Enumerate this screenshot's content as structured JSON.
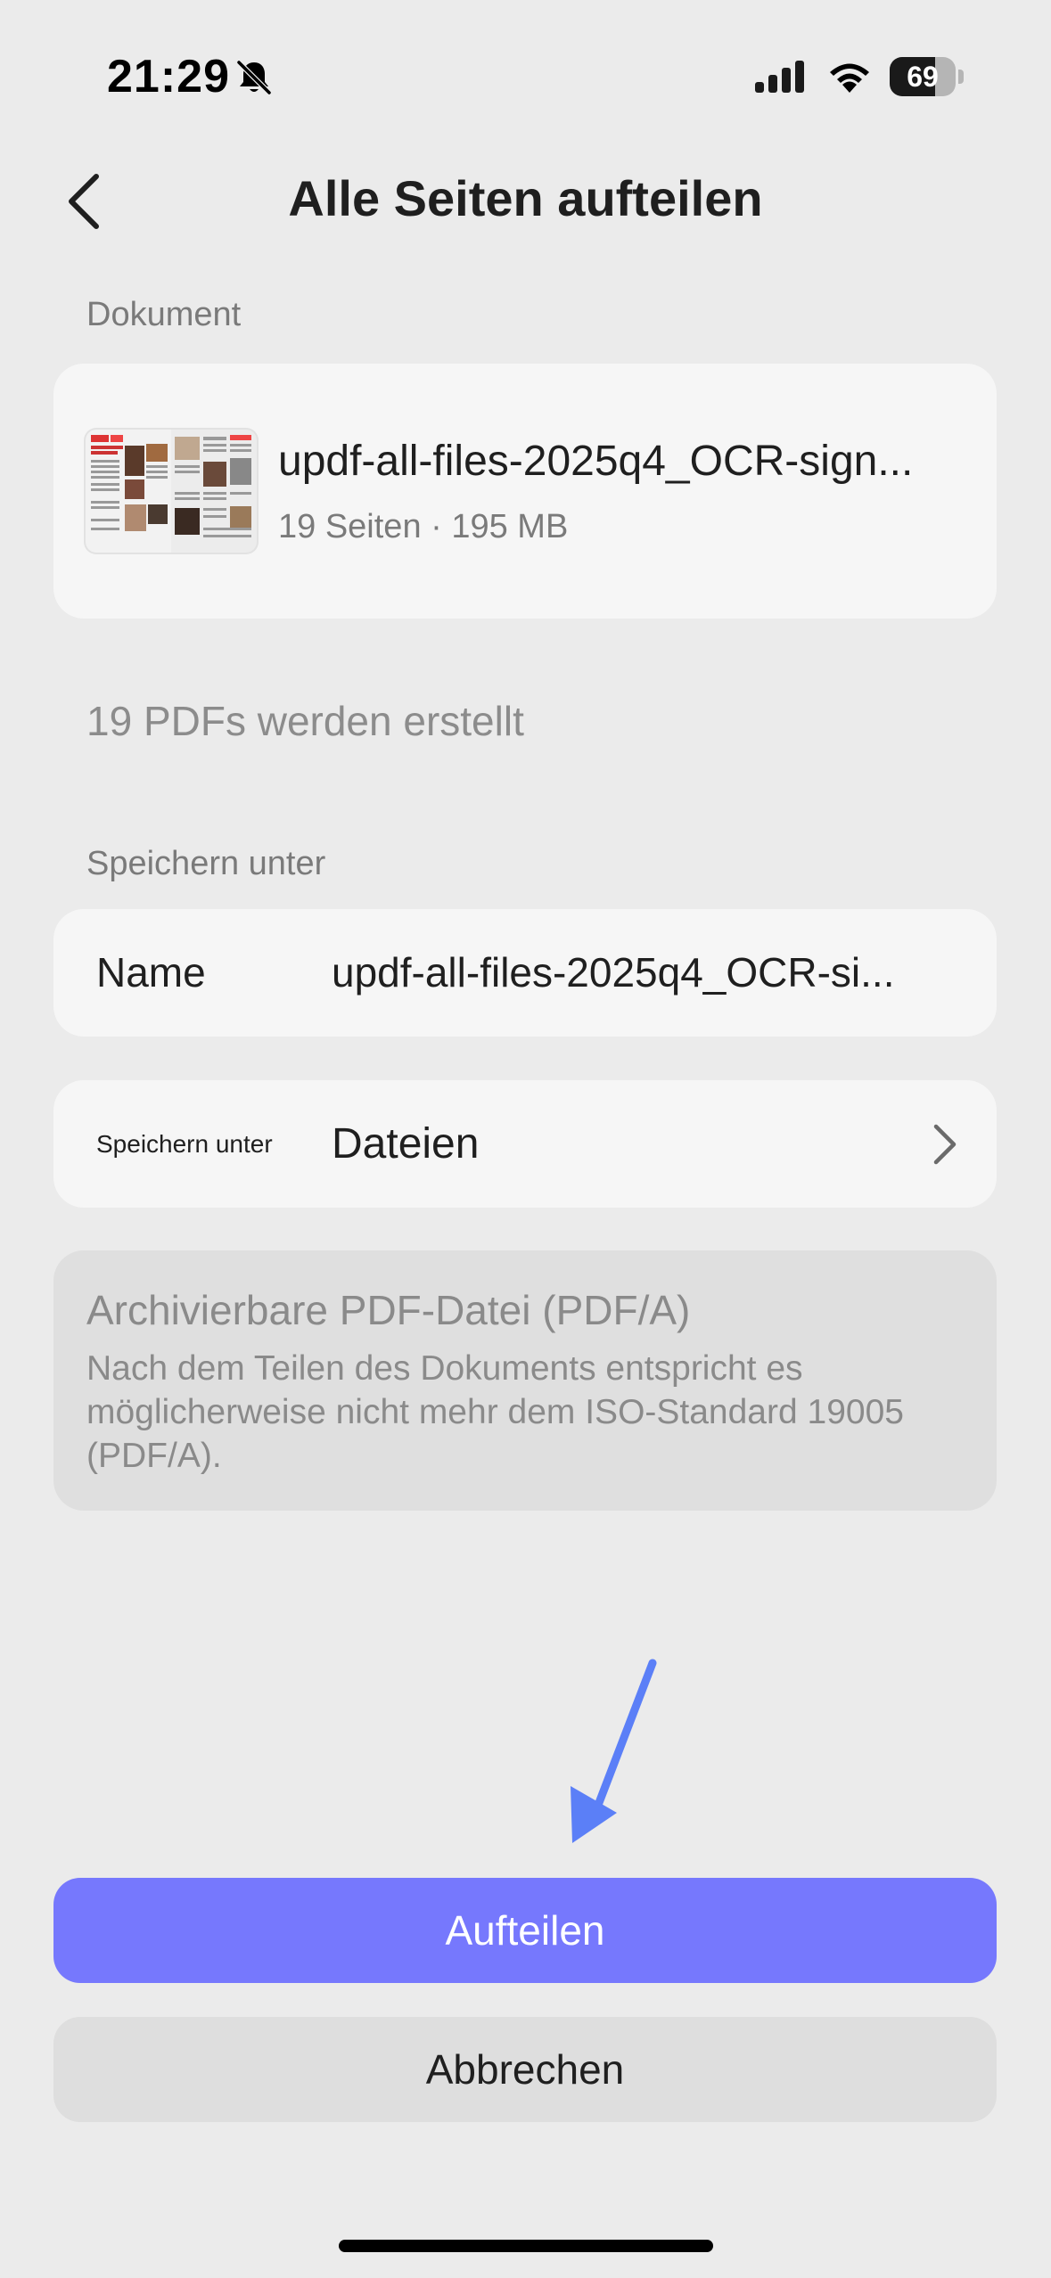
{
  "status_bar": {
    "time": "21:29",
    "battery_level": "69",
    "battery_fraction": 0.69
  },
  "header": {
    "title": "Alle Seiten aufteilen"
  },
  "document_section": {
    "label": "Dokument",
    "file_name": "updf-all-files-2025q4_OCR-sign...",
    "meta": "19 Seiten · 195 MB"
  },
  "pdf_count_text": "19 PDFs werden erstellt",
  "save_section": {
    "label": "Speichern unter",
    "name_label": "Name",
    "name_value": "updf-all-files-2025q4_OCR-si...",
    "location_label": "Speichern unter",
    "location_value": "Dateien"
  },
  "pdfa_notice": {
    "title": "Archivierbare PDF-Datei (PDF/A)",
    "description": "Nach dem Teilen des Dokuments entspricht es möglicherweise nicht mehr dem ISO-Standard 19005 (PDF/A)."
  },
  "buttons": {
    "primary_label": "Aufteilen",
    "secondary_label": "Abbrechen"
  },
  "colors": {
    "background": "#ebebeb",
    "card": "#f6f6f6",
    "disabled_card": "#dfdfdf",
    "primary": "#7678fd",
    "annotation_arrow": "#5b7ff7"
  },
  "icons": {
    "back": "chevron-left-icon",
    "bell": "bell-slash-icon",
    "signal": "cellular-signal-icon",
    "wifi": "wifi-icon",
    "battery": "battery-icon",
    "disclosure": "chevron-right-icon",
    "annotation": "arrow-pointer-icon"
  }
}
